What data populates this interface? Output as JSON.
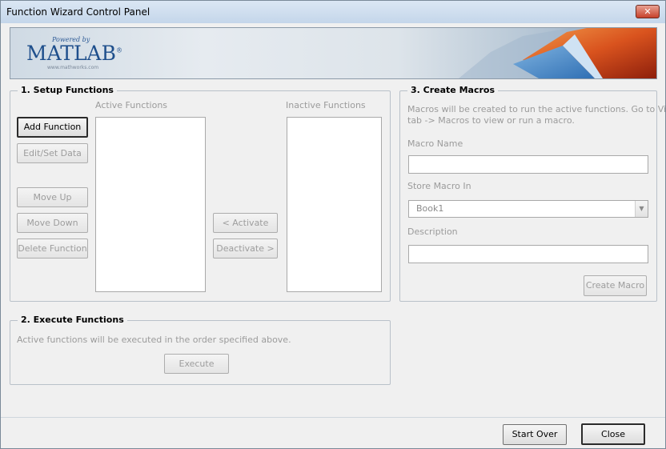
{
  "window": {
    "title": "Function Wizard Control Panel"
  },
  "banner": {
    "powered_by": "Powered by",
    "brand": "MATLAB",
    "brand_mark": "®",
    "site": "www.mathworks.com"
  },
  "setup": {
    "title": "1. Setup Functions",
    "active_label": "Active Functions",
    "inactive_label": "Inactive Functions",
    "active_items": [],
    "inactive_items": [],
    "buttons": {
      "add": "Add Function",
      "edit": "Edit/Set Data",
      "move_up": "Move Up",
      "move_down": "Move Down",
      "delete": "Delete Function",
      "activate": "< Activate",
      "deactivate": "Deactivate >"
    }
  },
  "execute": {
    "title": "2. Execute Functions",
    "info": "Active functions will be executed in the order specified above.",
    "button": "Execute"
  },
  "macros": {
    "title": "3. Create Macros",
    "info_line1": "Macros will be created to run the active functions. Go to View",
    "info_line2": "tab -> Macros to view or run a macro.",
    "name_label": "Macro Name",
    "name_value": "",
    "store_label": "Store Macro In",
    "store_value": "Book1",
    "desc_label": "Description",
    "desc_value": "",
    "create_button": "Create Macro"
  },
  "footer": {
    "start_over": "Start Over",
    "close": "Close"
  },
  "icons": {
    "close": "close-icon",
    "dropdown": "chevron-down-icon"
  }
}
